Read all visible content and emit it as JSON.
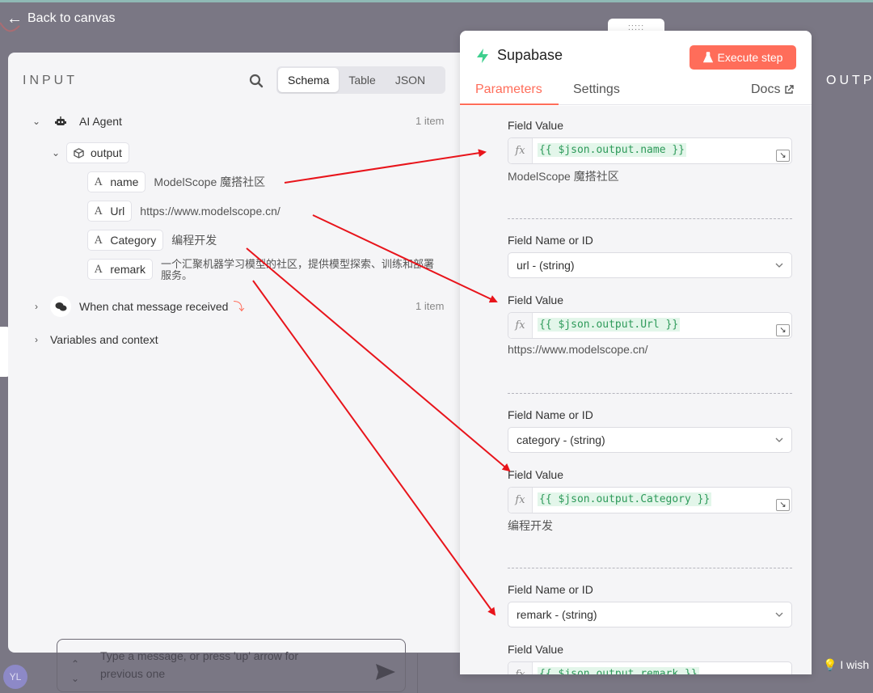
{
  "back": {
    "label": "Back to canvas"
  },
  "input_panel": {
    "title": "INPUT",
    "view_tabs": [
      "Schema",
      "Table",
      "JSON"
    ],
    "active_view": "Schema",
    "ai_agent": {
      "label": "AI Agent",
      "count": "1 item"
    },
    "output_key": "output",
    "fields": [
      {
        "key": "name",
        "value": "ModelScope 魔搭社区"
      },
      {
        "key": "Url",
        "value": "https://www.modelscope.cn/"
      },
      {
        "key": "Category",
        "value": "编程开发"
      },
      {
        "key": "remark",
        "value": "一个汇聚机器学习模型的社区，提供模型探索、训练和部署",
        "value2": "服务。"
      }
    ],
    "chat_trigger": {
      "label": "When chat message received",
      "count": "1 item"
    },
    "variables": {
      "label": "Variables and context"
    }
  },
  "chat": {
    "placeholder_line1": "Type a message, or press 'up' arrow for",
    "placeholder_line2": "previous one",
    "avatar_initials": "YL"
  },
  "wish_label": "I wish",
  "output_title": "OUTP",
  "node": {
    "title": "Supabase",
    "execute_label": "Execute step",
    "tabs": [
      "Parameters",
      "Settings"
    ],
    "docs_label": "Docs",
    "field_value_label": "Field Value",
    "field_name_label": "Field Name or ID",
    "fx": "fx",
    "groups": [
      {
        "select": "",
        "expression": "{{ $json.output.name }}",
        "result": "ModelScope 魔搭社区"
      },
      {
        "select": "url - (string)",
        "expression": "{{ $json.output.Url }}",
        "result": "https://www.modelscope.cn/"
      },
      {
        "select": "category - (string)",
        "expression": "{{ $json.output.Category }}",
        "result": "编程开发"
      },
      {
        "select": "remark - (string)",
        "expression": "{{ $json.output.remark }}",
        "result": ""
      }
    ]
  },
  "colors": {
    "accent": "#ff6d5a",
    "code_green": "#2e9a5a",
    "supabase_green": "#3ecf8e",
    "arrow_red": "#e8141b"
  }
}
